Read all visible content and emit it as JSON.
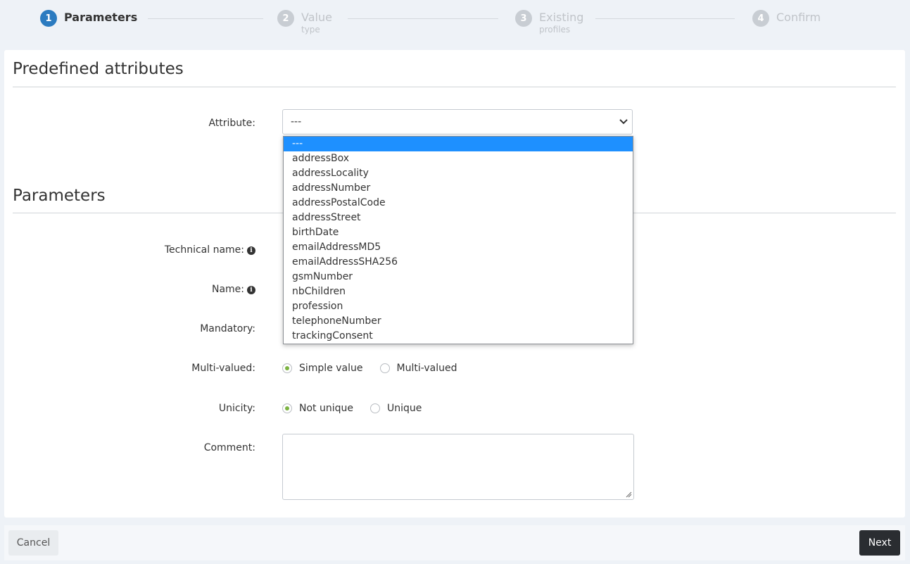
{
  "stepper": {
    "steps": [
      {
        "number": "1",
        "title": "Parameters",
        "subtitle": ""
      },
      {
        "number": "2",
        "title": "Value",
        "subtitle": "type"
      },
      {
        "number": "3",
        "title": "Existing",
        "subtitle": "profiles"
      },
      {
        "number": "4",
        "title": "Confirm",
        "subtitle": ""
      }
    ]
  },
  "predefined": {
    "title": "Predefined attributes",
    "attribute_label": "Attribute:",
    "selected_value": "---",
    "options": [
      "---",
      "addressBox",
      "addressLocality",
      "addressNumber",
      "addressPostalCode",
      "addressStreet",
      "birthDate",
      "emailAddressMD5",
      "emailAddressSHA256",
      "gsmNumber",
      "nbChildren",
      "profession",
      "telephoneNumber",
      "trackingConsent"
    ]
  },
  "parameters": {
    "title": "Parameters",
    "technical_name_label": "Technical name:",
    "name_label": "Name:",
    "mandatory_label": "Mandatory:",
    "multivalued_label": "Multi-valued:",
    "multivalued_options": [
      "Simple value",
      "Multi-valued"
    ],
    "unicity_label": "Unicity:",
    "unicity_options": [
      "Not unique",
      "Unique"
    ],
    "comment_label": "Comment:",
    "comment_value": ""
  },
  "footer": {
    "cancel_label": "Cancel",
    "next_label": "Next"
  },
  "colors": {
    "active_step": "#2b7bc0",
    "radio_checked": "#7cb342",
    "option_selected": "#1e90ff",
    "next_button": "#2a2d31"
  }
}
